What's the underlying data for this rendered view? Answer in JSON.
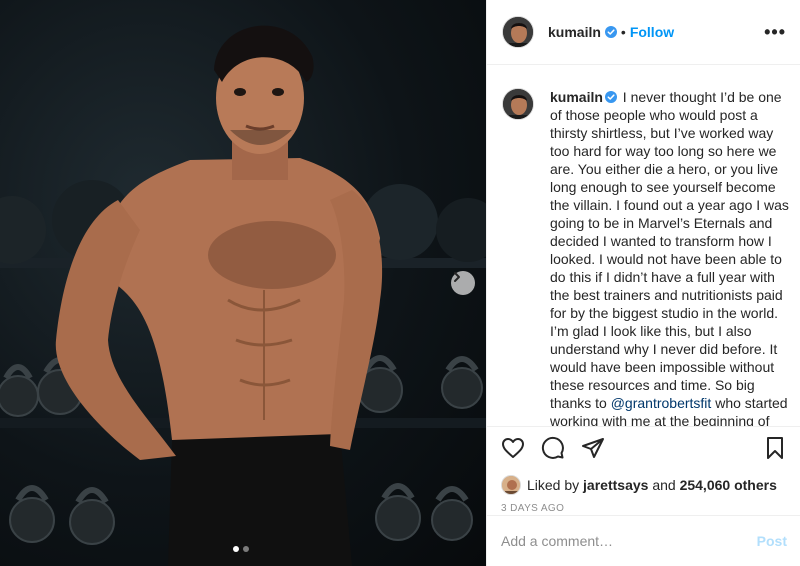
{
  "post": {
    "username": "kumailn",
    "verified": true,
    "separator": "•",
    "follow_label": "Follow",
    "more_label": "•••",
    "caption": {
      "username": "kumailn",
      "text_before_mention": "I never thought I’d be one of those people who would post a thirsty shirtless, but I’ve worked way too hard for way too long so here we are. You either die a hero, or you live long enough to see yourself become the villain. I found out a year ago I was going to be in Marvel’s Eternals and decided I wanted to transform how I looked. I would not have been able to do this if I didn’t have a full year with the best trainers and nutritionists paid for by the biggest studio in the world. I’m glad I look like this, but I also understand why I never did before. It would have been impossible without these resources and time. So big thanks to",
      "mention": "@grantrobertsfit",
      "text_after_mention": "who started working with me at the beginning of the year and made me understand true"
    },
    "likes": {
      "liked_by_prefix": "Liked by",
      "liked_by_user": "jarettsays",
      "and_word": "and",
      "others_count": "254,060 others"
    },
    "time_ago": "3 DAYS AGO",
    "comment": {
      "placeholder": "Add a comment…",
      "post_label": "Post"
    },
    "carousel": {
      "total_slides": 2,
      "current_slide": 1
    }
  },
  "colors": {
    "accent": "#0095f6",
    "verified": "#3897f0",
    "post_disabled": "#b2dffc",
    "muted": "#8e8e8e"
  },
  "icons": [
    "verified-badge-icon",
    "more-options-icon",
    "heart-icon",
    "comment-icon",
    "share-icon",
    "bookmark-icon",
    "carousel-next-icon"
  ]
}
